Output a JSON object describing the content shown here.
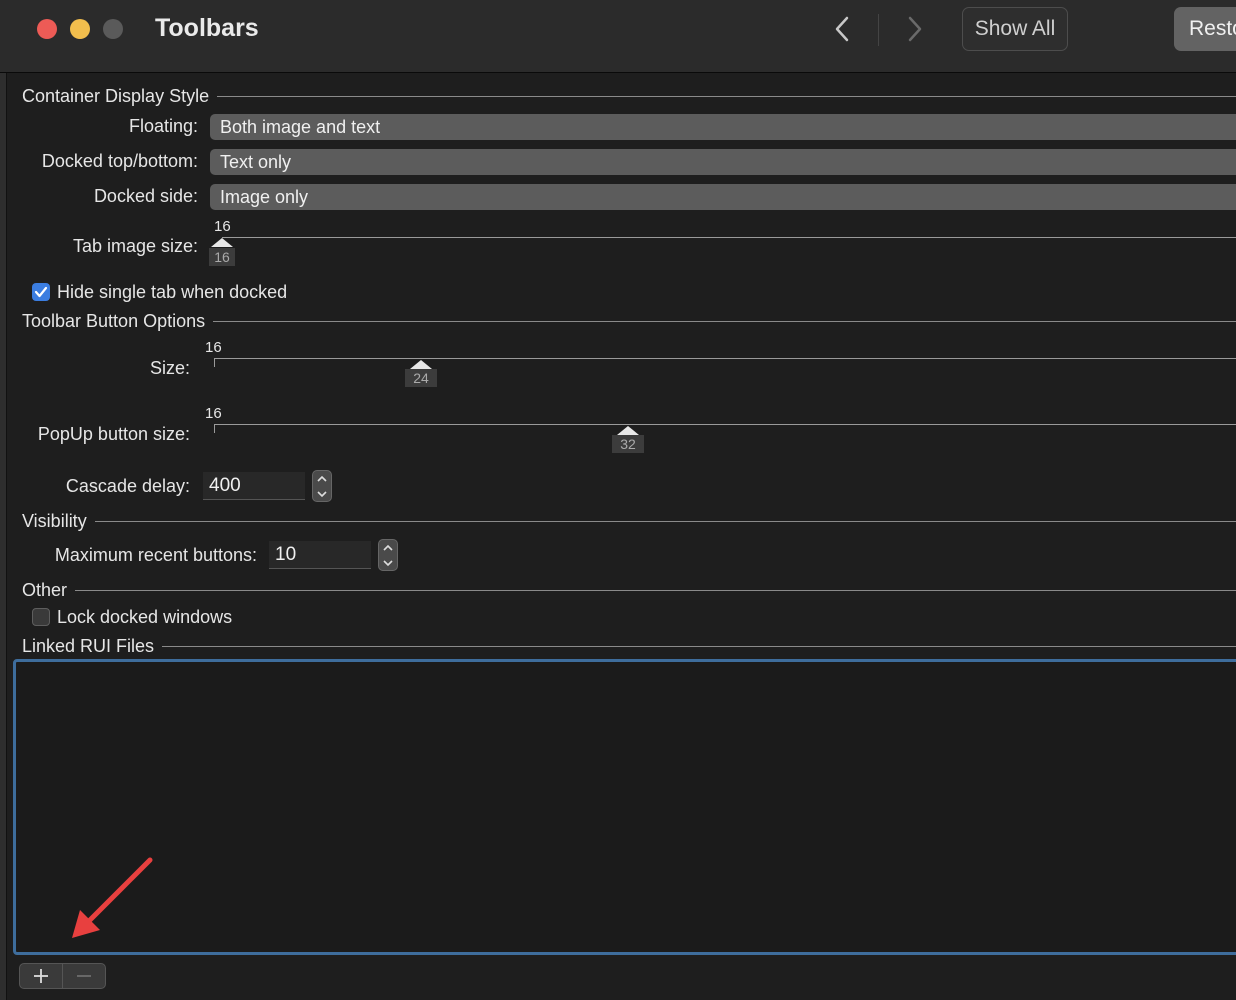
{
  "window": {
    "title": "Toolbars",
    "show_all_label": "Show All",
    "restore_label": "Restore"
  },
  "colors": {
    "close": "#ed5b56",
    "minimize": "#f2be4d",
    "zoom_disabled": "#5a5a5a",
    "accent": "#3b7de0",
    "list_border": "#3e6d9c",
    "arrow": "#e8403f"
  },
  "container_display_style": {
    "heading": "Container Display Style",
    "floating_label": "Floating:",
    "floating_value": "Both image and text",
    "docked_tb_label": "Docked top/bottom:",
    "docked_tb_value": "Text only",
    "docked_side_label": "Docked side:",
    "docked_side_value": "Image only",
    "tab_image_size_label": "Tab image size:",
    "tab_image_size_min": "16",
    "tab_image_size_value": "16",
    "hide_single_tab_label": "Hide single tab when docked",
    "hide_single_tab_checked": true
  },
  "toolbar_button_options": {
    "heading": "Toolbar Button Options",
    "size_label": "Size:",
    "size_min": "16",
    "size_value": "24",
    "popup_size_label": "PopUp button size:",
    "popup_size_min": "16",
    "popup_size_value": "32",
    "cascade_delay_label": "Cascade delay:",
    "cascade_delay_value": "400"
  },
  "visibility": {
    "heading": "Visibility",
    "max_recent_label": "Maximum recent buttons:",
    "max_recent_value": "10"
  },
  "other": {
    "heading": "Other",
    "lock_docked_label": "Lock docked windows",
    "lock_docked_checked": false
  },
  "linked_rui_files": {
    "heading": "Linked RUI Files"
  }
}
